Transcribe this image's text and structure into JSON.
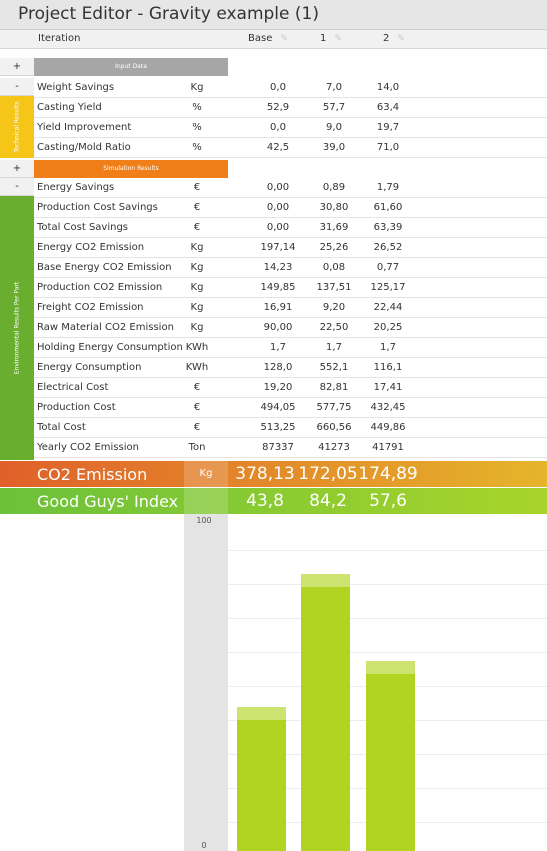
{
  "window": {
    "title": "Project Editor - Gravity example (1)"
  },
  "header": {
    "iteration_label": "Iteration",
    "columns": [
      "Base",
      "1",
      "2"
    ],
    "edit_icon": "pencil-icon"
  },
  "sections": {
    "input": {
      "label": "Input Data",
      "toggle": "+",
      "color": "#a6a6a6",
      "side_label": "Technical Results",
      "side_toggle": "-",
      "side_color": "#f5c518",
      "rows": [
        {
          "name": "Weight Savings",
          "unit": "Kg",
          "values": [
            "0,0",
            "7,0",
            "14,0"
          ]
        },
        {
          "name": "Casting Yield",
          "unit": "%",
          "values": [
            "52,9",
            "57,7",
            "63,4"
          ]
        },
        {
          "name": "Yield Improvement",
          "unit": "%",
          "values": [
            "0,0",
            "9,0",
            "19,7"
          ]
        },
        {
          "name": "Casting/Mold Ratio",
          "unit": "%",
          "values": [
            "42,5",
            "39,0",
            "71,0"
          ]
        }
      ]
    },
    "simulation": {
      "label": "Simulation Results",
      "toggle": "+",
      "color": "#f07f1a",
      "side_label": "Environmental Results Per Part",
      "side_toggle": "-",
      "side_color": "#6aae2f",
      "rows": [
        {
          "name": "Energy Savings",
          "unit": "€",
          "values": [
            "0,00",
            "0,89",
            "1,79"
          ]
        },
        {
          "name": "Production Cost Savings",
          "unit": "€",
          "values": [
            "0,00",
            "30,80",
            "61,60"
          ]
        },
        {
          "name": "Total Cost Savings",
          "unit": "€",
          "values": [
            "0,00",
            "31,69",
            "63,39"
          ]
        },
        {
          "name": "Energy CO2 Emission",
          "unit": "Kg",
          "values": [
            "197,14",
            "25,26",
            "26,52"
          ]
        },
        {
          "name": "Base Energy CO2 Emission",
          "unit": "Kg",
          "values": [
            "14,23",
            "0,08",
            "0,77"
          ]
        },
        {
          "name": "Production CO2 Emission",
          "unit": "Kg",
          "values": [
            "149,85",
            "137,51",
            "125,17"
          ]
        },
        {
          "name": "Freight CO2 Emission",
          "unit": "Kg",
          "values": [
            "16,91",
            "9,20",
            "22,44"
          ]
        },
        {
          "name": "Raw Material CO2 Emission",
          "unit": "Kg",
          "values": [
            "90,00",
            "22,50",
            "20,25"
          ]
        },
        {
          "name": "Holding Energy Consumption",
          "unit": "KWh",
          "values": [
            "1,7",
            "1,7",
            "1,7"
          ]
        },
        {
          "name": "Energy Consumption",
          "unit": "KWh",
          "values": [
            "128,0",
            "552,1",
            "116,1"
          ]
        },
        {
          "name": "Electrical Cost",
          "unit": "€",
          "values": [
            "19,20",
            "82,81",
            "17,41"
          ]
        },
        {
          "name": "Production Cost",
          "unit": "€",
          "values": [
            "494,05",
            "577,75",
            "432,45"
          ]
        },
        {
          "name": "Total Cost",
          "unit": "€",
          "values": [
            "513,25",
            "660,56",
            "449,86"
          ]
        },
        {
          "name": "Yearly CO2 Emission",
          "unit": "Ton",
          "values": [
            "87337",
            "41273",
            "41791"
          ]
        }
      ]
    }
  },
  "summary": {
    "co2": {
      "name": "CO2 Emission",
      "unit": "Kg",
      "values": [
        "378,13",
        "172,05",
        "174,89"
      ],
      "color_from": "#e0602a",
      "color_to": "#e5b52a"
    },
    "index": {
      "name": "Good Guys' Index",
      "unit": "",
      "values": [
        "43,8",
        "84,2",
        "57,6"
      ],
      "color_from": "#6cc13a",
      "color_to": "#a8d42a"
    }
  },
  "chart_data": {
    "type": "bar",
    "categories": [
      "Base",
      "1",
      "2"
    ],
    "values": [
      43.8,
      84.2,
      57.6
    ],
    "title": "",
    "xlabel": "",
    "ylabel": "",
    "ylim": [
      0,
      100
    ],
    "y_tick_labels": [
      "100",
      "0"
    ],
    "grid": true,
    "bar_color": "#b0d421"
  }
}
